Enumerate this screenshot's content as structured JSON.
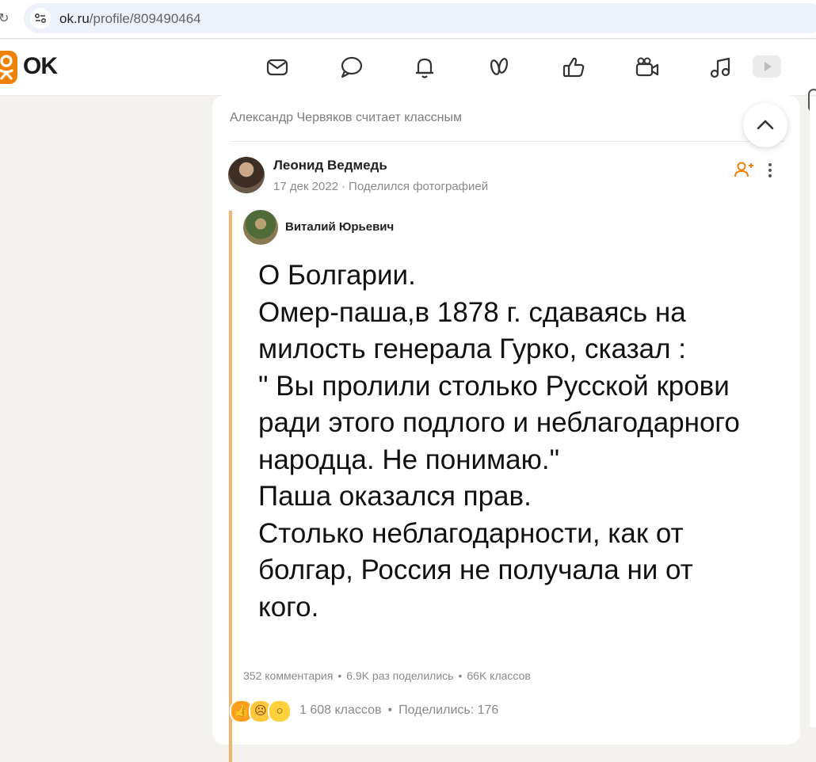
{
  "browser": {
    "url_host": "ok.ru",
    "url_path": "/profile/809490464"
  },
  "header": {
    "logo_text": "OK",
    "nav_icons": [
      "mail-icon",
      "chat-icon",
      "bell-icon",
      "guests-icon",
      "like-icon",
      "video-camera-icon",
      "music-icon",
      "video-play-icon"
    ],
    "accent_color": "#ee8208"
  },
  "feed": {
    "liked_by": "Александр Червяков считает классным",
    "post": {
      "author": "Леонид Ведмедь",
      "date": "17 дек 2022",
      "action": "Поделился фотографией",
      "reshared": {
        "author": "Виталий Юрьевич",
        "text": "О Болгарии.\nОмер-паша,в 1878 г. сдаваясь на милость генерала Гурко, сказал :\n\" Вы пролили столько Русской крови ради этого подлого и неблагодарного народца. Не понимаю.\"\nПаша оказался прав.\nСтолько неблагодарности, как от болгар, Россия не получала ни от кого.",
        "stats": {
          "comments": "352 комментария",
          "shares": "6.9K раз поделились",
          "classes": "66K классов"
        }
      },
      "reactions": {
        "classes": "1 608 классов",
        "shared": "Поделились: 176"
      }
    }
  }
}
